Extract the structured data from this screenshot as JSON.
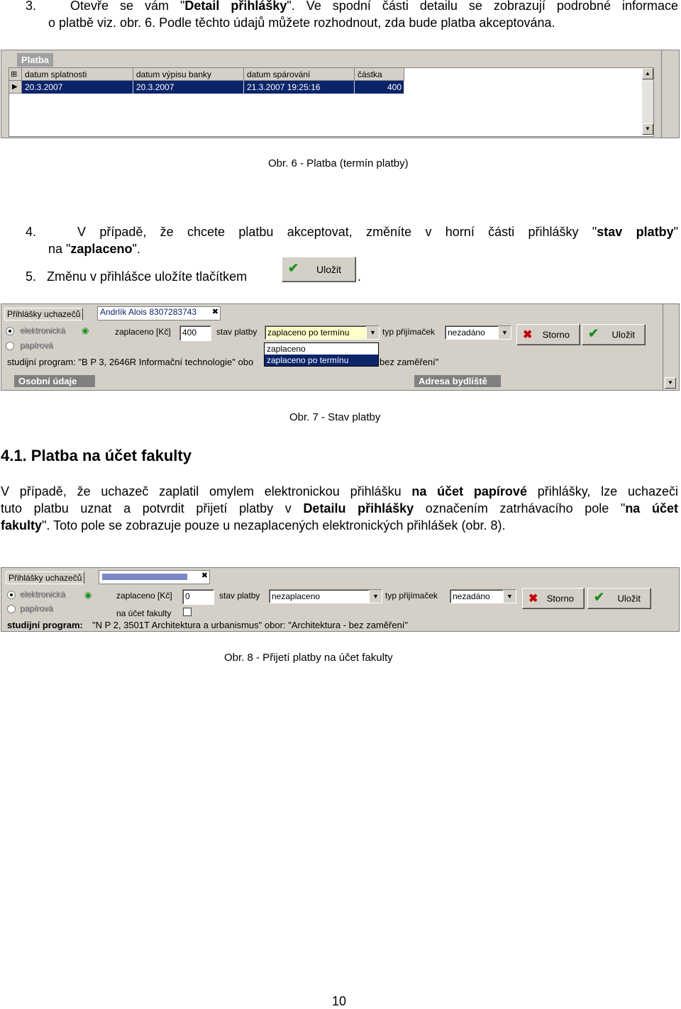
{
  "step3": {
    "num": "3.",
    "line1_a": "Otevře se vám \"",
    "line1_b": "Detail přihlášky",
    "line1_c": "\". Ve spodní části detailu se zobrazují podrobné informace",
    "line2": "o platbě  viz. obr. 6. Podle těchto údajů můžete rozhodnout, zda bude platba akceptována."
  },
  "fig6": {
    "tab": "Platba",
    "columns": [
      "datum splatnosti",
      "datum výpisu banky",
      "datum spárování",
      "částka"
    ],
    "row": [
      "20.3.2007",
      "20.3.2007",
      "21.3.2007 19:25:16",
      "400"
    ],
    "caption": "Obr. 6 - Platba (termín platby)"
  },
  "step4": {
    "num": "4.",
    "line1_a": "V případě, že chcete platbu akceptovat, změníte v horní části přihlášky \"",
    "line1_b": "stav platby",
    "line1_c": "\"",
    "line2_a": "na \"",
    "line2_b": "zaplaceno",
    "line2_c": "\"."
  },
  "step5": {
    "num": "5.",
    "text": "Změnu v přihlášce uložíte tlačítkem",
    "after": ".",
    "button": "Uložit"
  },
  "fig7": {
    "tab": "Přihlášky uchazečů",
    "applicant_tab": "Andrlík Alois 8307283743",
    "radio1": "elektronická",
    "radio2": "papírová",
    "paid_label": "zaplaceno [Kč]",
    "paid_value": "400",
    "stav_label": "stav platby",
    "stav_value": "zaplaceno po termínu",
    "typ_label": "typ přijímaček",
    "typ_value": "nezadáno",
    "storno": "Storno",
    "ulozit": "Uložit",
    "program": "studijní program: \"B P 3, 2646R Informační technologie\" obo",
    "program_tail": "bez zaměření\"",
    "options": [
      "zaplaceno",
      "zaplaceno po termínu"
    ],
    "tab_osobni": "Osobní údaje",
    "tab_adresa": "Adresa bydliště",
    "caption": "Obr. 7 - Stav platby"
  },
  "section": {
    "heading": "4.1. Platba na účet fakulty",
    "p1_a": "V případě, že uchazeč zaplatil omylem elektronickou přihlášku ",
    "p1_b": "na účet papírové",
    "p1_c": " přihlášky, lze uchazeči",
    "p2_a": "tuto platbu uznat a potvrdit přijetí platby v ",
    "p2_b": "Detailu přihlášky",
    "p2_c": " označením zatrhávacího pole \"",
    "p2_d": "na účet",
    "p3_a": "fakulty",
    "p3_b": "\". Toto pole se zobrazuje pouze u nezaplacených elektronických přihlášek (obr. 8)."
  },
  "fig8": {
    "tab": "Přihlášky uchazečů",
    "radio1": "elektronická",
    "radio2": "papírová",
    "paid_label": "zaplaceno [Kč]",
    "paid_value": "0",
    "account_label": "na účet fakulty",
    "stav_label": "stav platby",
    "stav_value": "nezaplaceno",
    "typ_label": "typ přijímaček",
    "typ_value": "nezadáno",
    "storno": "Storno",
    "ulozit": "Uložit",
    "program_label": "studijní program:",
    "program": "\"N P 2, 3501T Architektura a urbanismus\" obor: \"Architektura - bez zaměření\"",
    "caption": "Obr. 8 - Přijetí platby na účet fakulty"
  },
  "page_number": "10"
}
